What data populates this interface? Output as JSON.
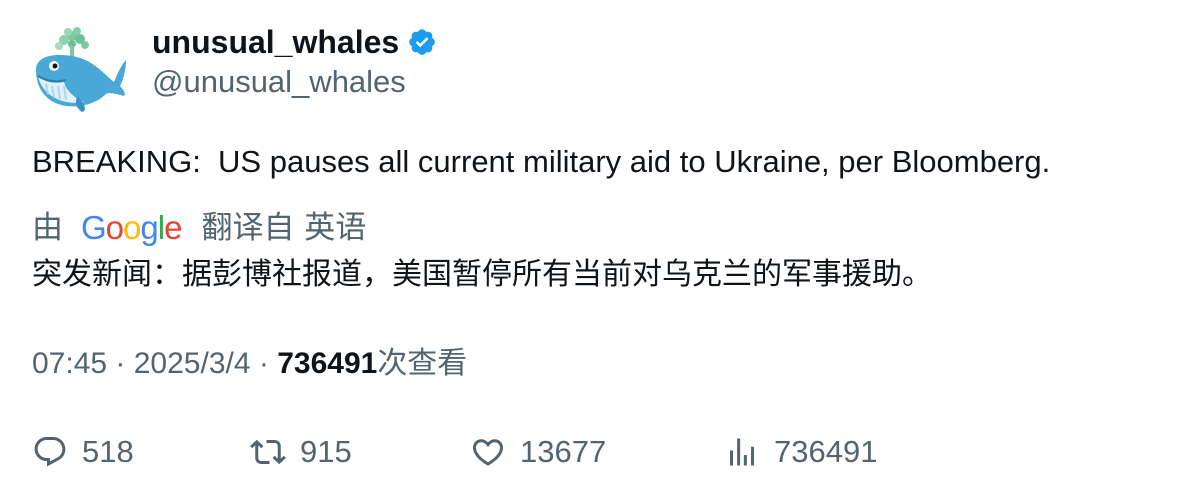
{
  "author": {
    "display_name": "unusual_whales",
    "handle": "@unusual_whales",
    "verified": true,
    "avatar_icon": "whale-icon"
  },
  "tweet": {
    "text": "BREAKING:  US pauses all current military aid to Ukraine, per Bloomberg."
  },
  "translation": {
    "prefix": "由",
    "provider": "Google",
    "suffix": "翻译自 英语",
    "text": "突发新闻：据彭博社报道，美国暂停所有当前对乌克兰的军事援助。"
  },
  "meta": {
    "time": "07:45",
    "separator": " · ",
    "date": "2025/3/4",
    "views_count": "736491",
    "views_label": "次查看"
  },
  "actions": {
    "replies": "518",
    "retweets": "915",
    "likes": "13677",
    "views": "736491"
  },
  "colors": {
    "text": "#0f1419",
    "secondary": "#536471",
    "verified": "#1d9bf0",
    "google_blue": "#4285F4",
    "google_red": "#EA4335",
    "google_yellow": "#FBBC05",
    "google_green": "#34A853"
  }
}
